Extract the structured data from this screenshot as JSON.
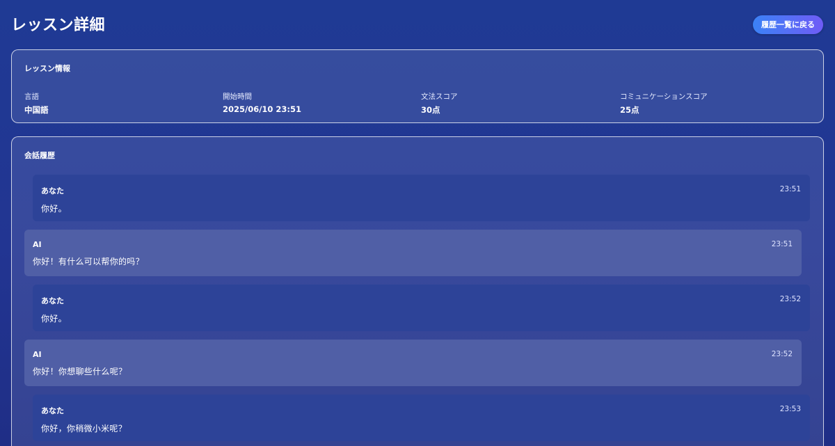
{
  "header": {
    "title": "レッスン詳細",
    "back_button_label": "履歴一覧に戻る"
  },
  "lesson_info": {
    "title": "レッスン情報",
    "fields": [
      {
        "label": "言語",
        "value": "中国語"
      },
      {
        "label": "開始時間",
        "value": "2025/06/10 23:51"
      },
      {
        "label": "文法スコア",
        "value": "30点"
      },
      {
        "label": "コミュニケーションスコア",
        "value": "25点"
      }
    ]
  },
  "history": {
    "title": "会話履歴",
    "messages": [
      {
        "role": "user",
        "sender": "あなた",
        "time": "23:51",
        "text": "你好。"
      },
      {
        "role": "ai",
        "sender": "AI",
        "time": "23:51",
        "text": "你好！有什么可以帮你的吗？"
      },
      {
        "role": "user",
        "sender": "あなた",
        "time": "23:52",
        "text": "你好。"
      },
      {
        "role": "ai",
        "sender": "AI",
        "time": "23:52",
        "text": "你好！你想聊些什么呢？"
      },
      {
        "role": "user",
        "sender": "あなた",
        "time": "23:53",
        "text": "你好，你稍微小米呢？"
      }
    ]
  },
  "colors": {
    "background": "#1f3a94",
    "user_bubble": "#2d4398",
    "ai_bubble": "#505fa6",
    "button_gradient_start": "#3b82f6",
    "button_gradient_end": "#6f5cf6"
  }
}
